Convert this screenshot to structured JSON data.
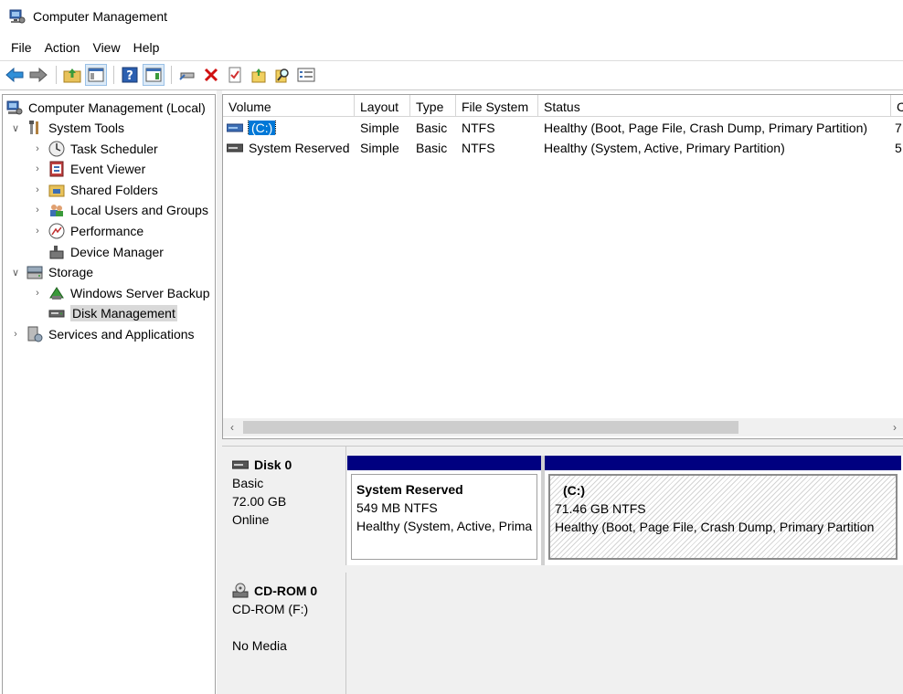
{
  "window": {
    "title": "Computer Management"
  },
  "menu": [
    "File",
    "Action",
    "View",
    "Help"
  ],
  "toolbar": {
    "buttons": [
      "back-arrow-icon",
      "forward-arrow-icon",
      "folder-up-icon",
      "show-hide-tree-icon",
      "help-icon",
      "show-hide-action-pane-icon",
      "connect-drive-icon",
      "delete-icon",
      "properties-icon",
      "folder-open-icon",
      "search-icon",
      "list-icon"
    ]
  },
  "tree": {
    "root": "Computer Management (Local)",
    "system_tools": "System Tools",
    "task_scheduler": "Task Scheduler",
    "event_viewer": "Event Viewer",
    "shared_folders": "Shared Folders",
    "local_users": "Local Users and Groups",
    "performance": "Performance",
    "device_manager": "Device Manager",
    "storage": "Storage",
    "windows_server_backup": "Windows Server Backup",
    "disk_management": "Disk Management",
    "services": "Services and Applications"
  },
  "volumes": {
    "headers": [
      "Volume",
      "Layout",
      "Type",
      "File System",
      "Status",
      "C"
    ],
    "rows": [
      {
        "volume": "(C:)",
        "layout": "Simple",
        "type": "Basic",
        "fs": "NTFS",
        "status": "Healthy (Boot, Page File, Crash Dump, Primary Partition)",
        "capacity": "7"
      },
      {
        "volume": "System Reserved",
        "layout": "Simple",
        "type": "Basic",
        "fs": "NTFS",
        "status": "Healthy (System, Active, Primary Partition)",
        "capacity": "5"
      }
    ]
  },
  "disks": {
    "disk0": {
      "name": "Disk 0",
      "type": "Basic",
      "size": "72.00 GB",
      "state": "Online",
      "partitions": [
        {
          "name": "System Reserved",
          "size": "549 MB NTFS",
          "status": "Healthy (System, Active, Prima"
        },
        {
          "name": "(C:)",
          "size": "71.46 GB NTFS",
          "status": "Healthy (Boot, Page File, Crash Dump, Primary Partition"
        }
      ]
    },
    "cdrom0": {
      "name": "CD-ROM 0",
      "drive": "CD-ROM (F:)",
      "media": "No Media"
    }
  },
  "colors": {
    "selection": "#0078d7",
    "partition_bar": "#000080",
    "panel_bg": "#f0f0f0"
  }
}
